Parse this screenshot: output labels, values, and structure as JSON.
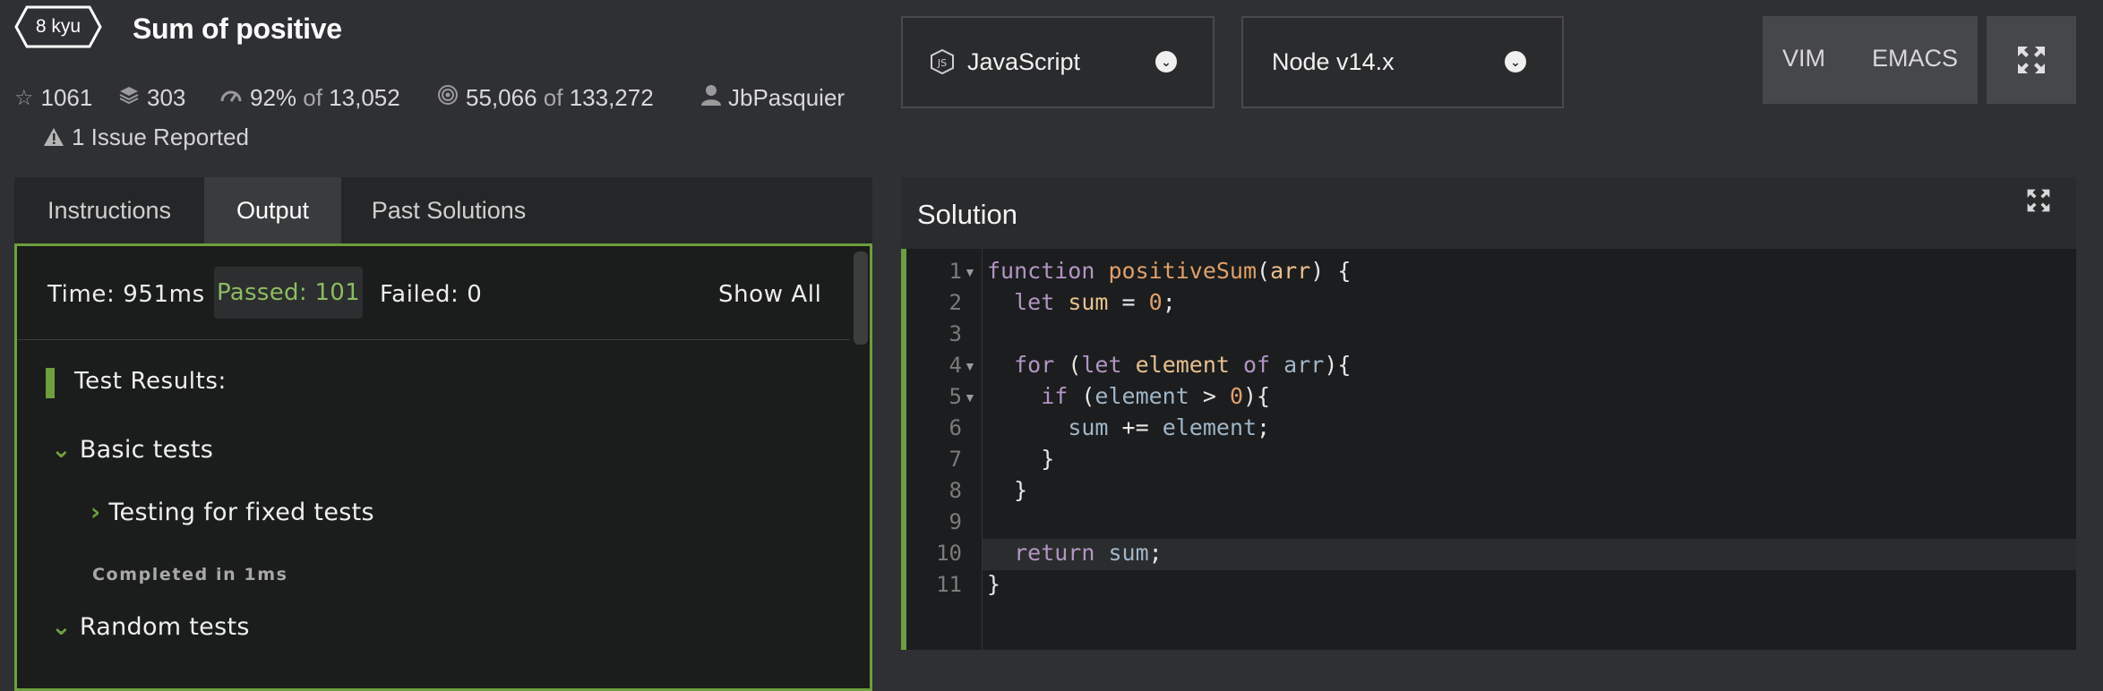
{
  "kata": {
    "rank": "8 kyu",
    "title": "Sum of positive",
    "stars": "1061",
    "collections": "303",
    "satisfaction": "92%",
    "of1": "of",
    "votes": "13,052",
    "completed": "55,066",
    "of2": "of",
    "attempts": "133,272",
    "author": "JbPasquier",
    "issues": "1 Issue Reported"
  },
  "toolbar": {
    "language": "JavaScript",
    "version": "Node v14.x",
    "vim": "VIM",
    "emacs": "EMACS"
  },
  "tabs": [
    "Instructions",
    "Output",
    "Past Solutions"
  ],
  "output": {
    "time": "Time: 951ms",
    "passed": "Passed: 101",
    "failed": "Failed: 0",
    "show_all": "Show All",
    "results_title": "Test Results:",
    "group1": "Basic tests",
    "subgroup1": "Testing for fixed tests",
    "completed": "Completed in 1ms",
    "group2": "Random tests"
  },
  "solution": {
    "title": "Solution",
    "line_numbers": [
      "1",
      "2",
      "3",
      "4",
      "5",
      "6",
      "7",
      "8",
      "9",
      "10",
      "11"
    ]
  },
  "colors": {
    "accent": "#6d9f3e",
    "background": "#2f3033"
  }
}
